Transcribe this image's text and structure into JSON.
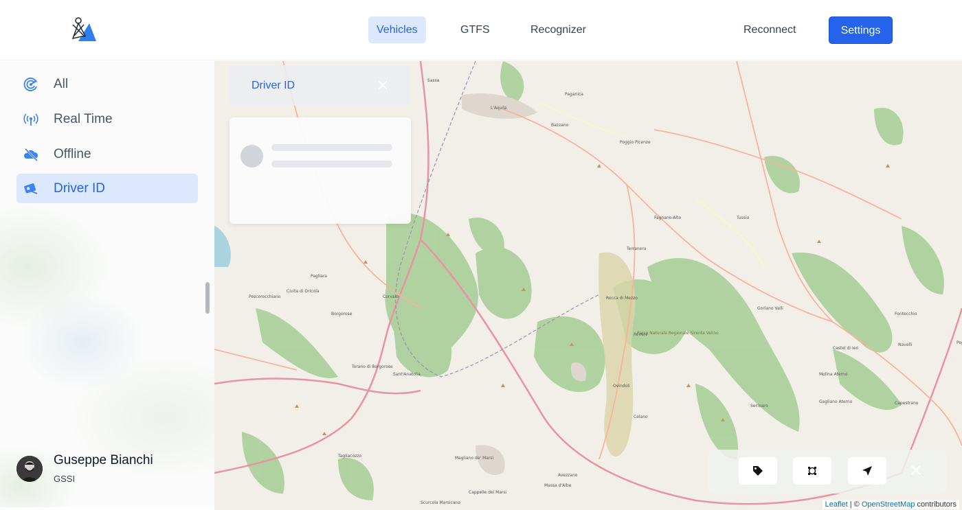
{
  "header": {
    "nav": [
      {
        "label": "Vehicles",
        "active": true
      },
      {
        "label": "GTFS",
        "active": false
      },
      {
        "label": "Recognizer",
        "active": false
      }
    ],
    "reconnect_label": "Reconnect",
    "settings_label": "Settings",
    "accent_color": "#2563eb"
  },
  "sidebar": {
    "items": [
      {
        "label": "All",
        "icon": "radar-icon",
        "active": false
      },
      {
        "label": "Real Time",
        "icon": "broadcast-icon",
        "active": false
      },
      {
        "label": "Offline",
        "icon": "cloud-offline-icon",
        "active": false
      },
      {
        "label": "Driver ID",
        "icon": "id-card-icon",
        "active": true
      }
    ],
    "user": {
      "name": "Guseppe Bianchi",
      "org": "GSSI"
    }
  },
  "panel": {
    "title": "Driver ID"
  },
  "map": {
    "place_labels": [
      "L'Aquila",
      "Rocca di Mezzo",
      "Celano",
      "Ovindoli",
      "Avezzano",
      "Tagliacozzo",
      "Fontecchio",
      "Navelli",
      "Popoli",
      "Parco Naturale Regionale Sirente Velino",
      "Capestrano",
      "Sassa",
      "Paganica",
      "Bazzano",
      "Poggio Picenze",
      "Tussio",
      "Molina Aterno",
      "Gagliano Aterno",
      "Secinaro",
      "Goriano Valli",
      "Castel di Ieri",
      "Torano di Borgorose",
      "Sant'Anatolia",
      "Magliano de' Marsi",
      "Cappelle dei Marsi",
      "Scurcola Marsicana",
      "Massa d'Albe",
      "Corvaro",
      "Borgorose",
      "Rovere",
      "Terranera",
      "Fagnano Alto",
      "Civita di Oricola",
      "Pescorocchiano",
      "Pagliara"
    ],
    "toolbar": [
      "tag-icon",
      "select-area-icon",
      "locate-icon",
      "close-icon"
    ],
    "attribution": {
      "leaflet": "Leaflet",
      "sep": " | © ",
      "osm": "OpenStreetMap",
      "rest": " contributors"
    }
  }
}
